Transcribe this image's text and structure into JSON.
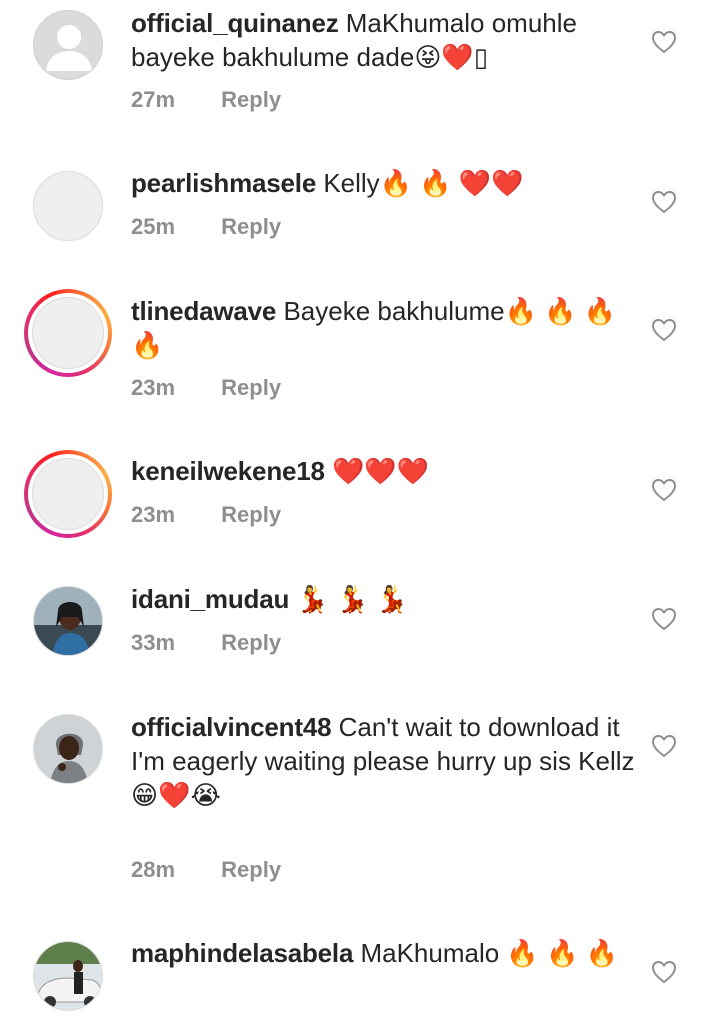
{
  "comments": [
    {
      "username": "official_quinanez",
      "text": "MaKhumalo omuhle bayeke bakhulume dade😝❤️▯",
      "time": "27m",
      "reply": "Reply"
    },
    {
      "username": "pearlishmasele",
      "text": "Kelly🔥 🔥 ❤️❤️",
      "time": "25m",
      "reply": "Reply"
    },
    {
      "username": "tlinedawave",
      "text": "Bayeke bakhulume🔥 🔥 🔥 🔥",
      "time": "23m",
      "reply": "Reply"
    },
    {
      "username": "keneilwekene18",
      "text": "❤️❤️❤️",
      "time": "23m",
      "reply": "Reply"
    },
    {
      "username": "idani_mudau",
      "text": "💃 💃 💃",
      "time": "33m",
      "reply": "Reply"
    },
    {
      "username": "officialvincent48",
      "text": "Can't wait to download it",
      "text2": "I'm eagerly waiting please hurry up sis Kellz😁❤️😭",
      "time": "28m",
      "reply": "Reply"
    },
    {
      "username": "maphindelasabela",
      "text": "MaKhumalo 🔥 🔥 🔥",
      "time": "",
      "reply": ""
    }
  ]
}
